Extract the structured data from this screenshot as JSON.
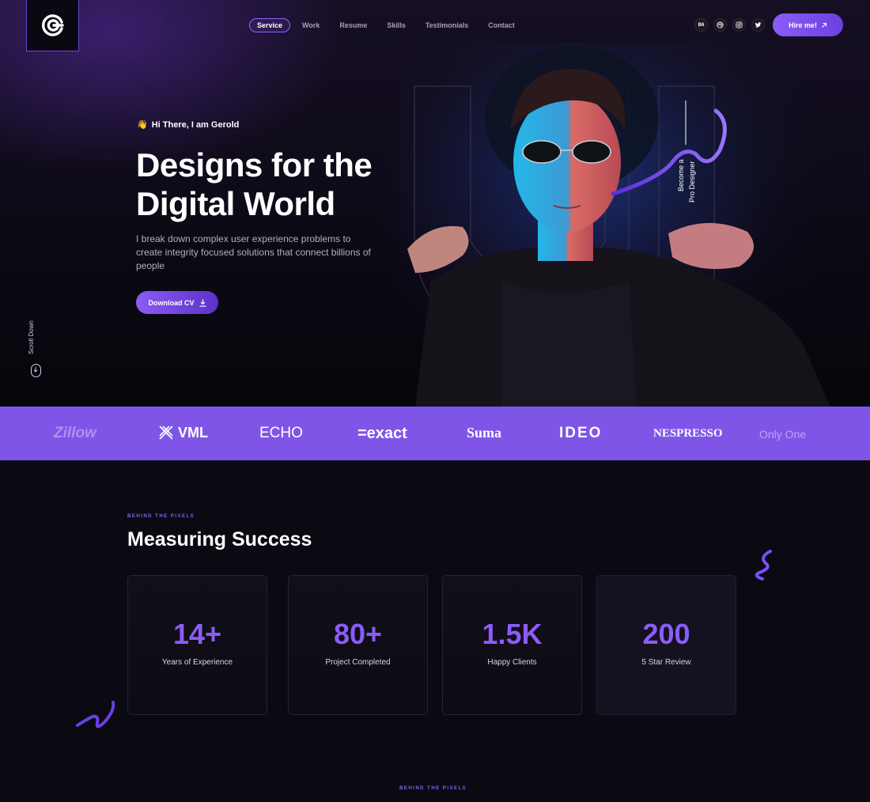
{
  "nav": {
    "items": [
      {
        "label": "Service",
        "active": true
      },
      {
        "label": "Work",
        "active": false
      },
      {
        "label": "Resume",
        "active": false
      },
      {
        "label": "Skills",
        "active": false
      },
      {
        "label": "Testimonials",
        "active": false
      },
      {
        "label": "Contact",
        "active": false
      }
    ],
    "socials": [
      "Bē",
      "dribbble-icon",
      "instagram-icon",
      "twitter-icon"
    ],
    "social_behance": "B6",
    "hire_label": "Hire me!"
  },
  "hero": {
    "greeting_emoji": "👋",
    "greeting": "Hi There, I am Gerold",
    "headline_line1": "Designs for the",
    "headline_line2": "Digital World",
    "description": "I break down complex user experience problems to create integrity focused solutions that connect billions of people",
    "download_label": "Download CV",
    "scroll_label": "Scroll Down",
    "side_label_line1": "Become a",
    "side_label_line2": "Pro Designer"
  },
  "brands": [
    "Zillow",
    "VML",
    "ECHO",
    "=exact",
    "Suma",
    "IDEO",
    "NESPRESSO",
    "Only One"
  ],
  "stats": {
    "eyebrow": "BEHIND THE PIXELS",
    "title": "Measuring Success",
    "cards": [
      {
        "value": "14+",
        "label": "Years of Experience"
      },
      {
        "value": "80+",
        "label": "Project Completed"
      },
      {
        "value": "1.5K",
        "label": "Happy Clients"
      },
      {
        "value": "200",
        "label": "5 Star Review"
      }
    ],
    "next_eyebrow": "BEHIND THE PIXELS"
  },
  "colors": {
    "accent": "#8b5cf6",
    "brand_bar": "#7f55e8",
    "background": "#0b0912"
  }
}
